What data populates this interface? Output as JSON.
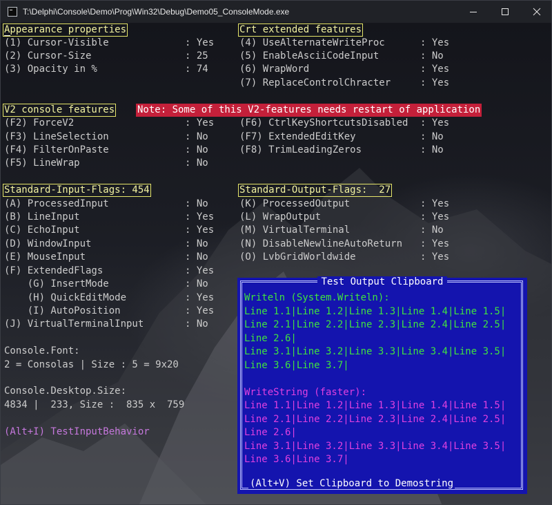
{
  "window": {
    "title": "T:\\Delphi\\Console\\Demo\\Prog\\Win32\\Debug\\Demo05_ConsoleMode.exe"
  },
  "appearance": {
    "heading": "Appearance properties",
    "items": [
      {
        "label": "(1) Cursor-Visible",
        "value": ": Yes"
      },
      {
        "label": "(2) Cursor-Size",
        "value": ": 25"
      },
      {
        "label": "(3) Opacity in %",
        "value": ": 74"
      }
    ]
  },
  "crt": {
    "heading": "Crt extended features",
    "items": [
      {
        "label": "(4) UseAlternateWriteProc",
        "value": ": Yes"
      },
      {
        "label": "(5) EnableAsciiCodeInput",
        "value": ": No"
      },
      {
        "label": "(6) WrapWord",
        "value": ": Yes"
      },
      {
        "label": "(7) ReplaceControlChracter",
        "value": ": Yes"
      }
    ]
  },
  "v2": {
    "heading": "V2 console features",
    "note": "Note: Some of this V2-features needs restart of application",
    "left": [
      {
        "label": "(F2) ForceV2",
        "value": ": Yes"
      },
      {
        "label": "(F3) LineSelection",
        "value": ": No"
      },
      {
        "label": "(F4) FilterOnPaste",
        "value": ": No"
      },
      {
        "label": "(F5) LineWrap",
        "value": ": No"
      }
    ],
    "right": [
      {
        "label": "(F6) CtrlKeyShortcutsDisabled",
        "value": ": Yes"
      },
      {
        "label": "(F7) ExtendedEditKey",
        "value": ": No"
      },
      {
        "label": "(F8) TrimLeadingZeros",
        "value": ": No"
      }
    ]
  },
  "input_flags": {
    "heading": "Standard-Input-Flags: 454",
    "items": [
      {
        "label": "(A) ProcessedInput",
        "value": ": No"
      },
      {
        "label": "(B) LineInput",
        "value": ": Yes"
      },
      {
        "label": "(C) EchoInput",
        "value": ": Yes"
      },
      {
        "label": "(D) WindowInput",
        "value": ": No"
      },
      {
        "label": "(E) MouseInput",
        "value": ": No"
      },
      {
        "label": "(F) ExtendedFlags",
        "value": ": Yes"
      },
      {
        "label": "    (G) InsertMode",
        "value": ": No"
      },
      {
        "label": "    (H) QuickEditMode",
        "value": ": Yes"
      },
      {
        "label": "    (I) AutoPosition",
        "value": ": Yes"
      },
      {
        "label": "(J) VirtualTerminalInput",
        "value": ": No"
      }
    ]
  },
  "output_flags": {
    "heading": "Standard-Output-Flags:  27",
    "items": [
      {
        "label": "(K) ProcessedOutput",
        "value": ": Yes"
      },
      {
        "label": "(L) WrapOutput",
        "value": ": Yes"
      },
      {
        "label": "(M) VirtualTerminal",
        "value": ": No"
      },
      {
        "label": "(N) DisableNewlineAutoReturn",
        "value": ": Yes"
      },
      {
        "label": "(O) LvbGridWorldwide",
        "value": ": Yes"
      }
    ]
  },
  "font": {
    "label": "Console.Font:",
    "value": "2 = Consolas | Size : 5 = 9x20"
  },
  "desktop": {
    "label": "Console.Desktop.Size:",
    "value": "4834 |  233, Size :  835 x  759"
  },
  "test_input": "(Alt+I) TestInputBehavior",
  "clipboard": {
    "title": "Test Output Clipboard",
    "writeln_heading": "Writeln (System.Writeln):",
    "writeln_lines": [
      "Line 1.1|Line 1.2|Line 1.3|Line 1.4|Line 1.5|",
      "Line 2.1|Line 2.2|Line 2.3|Line 2.4|Line 2.5|",
      "Line 2.6|",
      "Line 3.1|Line 3.2|Line 3.3|Line 3.4|Line 3.5|",
      "Line 3.6|Line 3.7|"
    ],
    "writestring_heading": "WriteString (faster):",
    "writestring_lines": [
      "Line 1.1|Line 1.2|Line 1.3|Line 1.4|Line 1.5|",
      "Line 2.1|Line 2.2|Line 2.3|Line 2.4|Line 2.5|",
      "Line 2.6|",
      "Line 3.1|Line 3.2|Line 3.3|Line 3.4|Line 3.5|",
      "Line 3.6|Line 3.7|"
    ],
    "footer": "(Alt+V) Set Clipboard to Demostring"
  }
}
